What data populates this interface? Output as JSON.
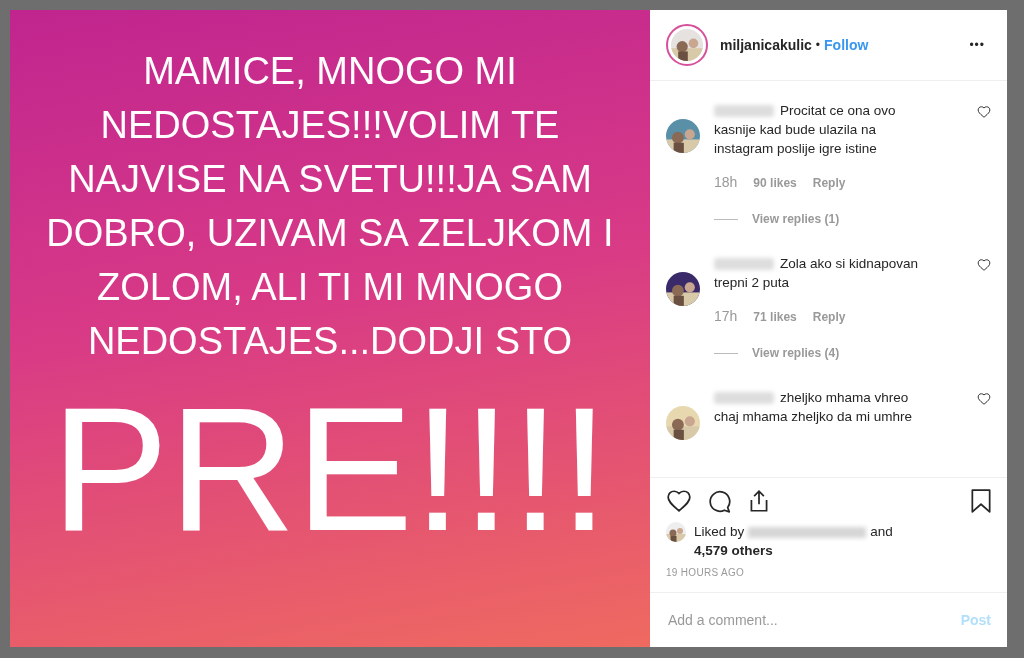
{
  "story": {
    "lines": [
      "MAMICE, MNOGO MI",
      "NEDOSTAJES!!!VOLIM TE",
      "NAJVISE NA SVETU!!!JA SAM",
      "DOBRO, UZIVAM SA ZELJKOM I",
      "ZOLOM, ALI TI MI MNOGO",
      "NEDOSTAJES...DODJI STO"
    ],
    "big": "PRE!!!!"
  },
  "header": {
    "username": "miljanicakulic",
    "separator": "•",
    "follow": "Follow",
    "more": "•••"
  },
  "comments": [
    {
      "text": "Procitat ce ona ovo kasnije kad bude ulazila na instagram poslije igre istine",
      "time": "18h",
      "likes": "90 likes",
      "reply": "Reply",
      "view_replies": "View replies (1)"
    },
    {
      "text": "Zola ako si kidnapovan trepni 2 puta",
      "time": "17h",
      "likes": "71 likes",
      "reply": "Reply",
      "view_replies": "View replies (4)"
    },
    {
      "text": "zheljko mhama vhreo chaj mhama zheljko da mi umhre"
    }
  ],
  "liked": {
    "prefix": "Liked by",
    "suffix": "and",
    "others": "4,579 others"
  },
  "time_ago": "19 HOURS AGO",
  "comment_field": {
    "placeholder": "Add a comment..."
  },
  "post_button": "Post"
}
